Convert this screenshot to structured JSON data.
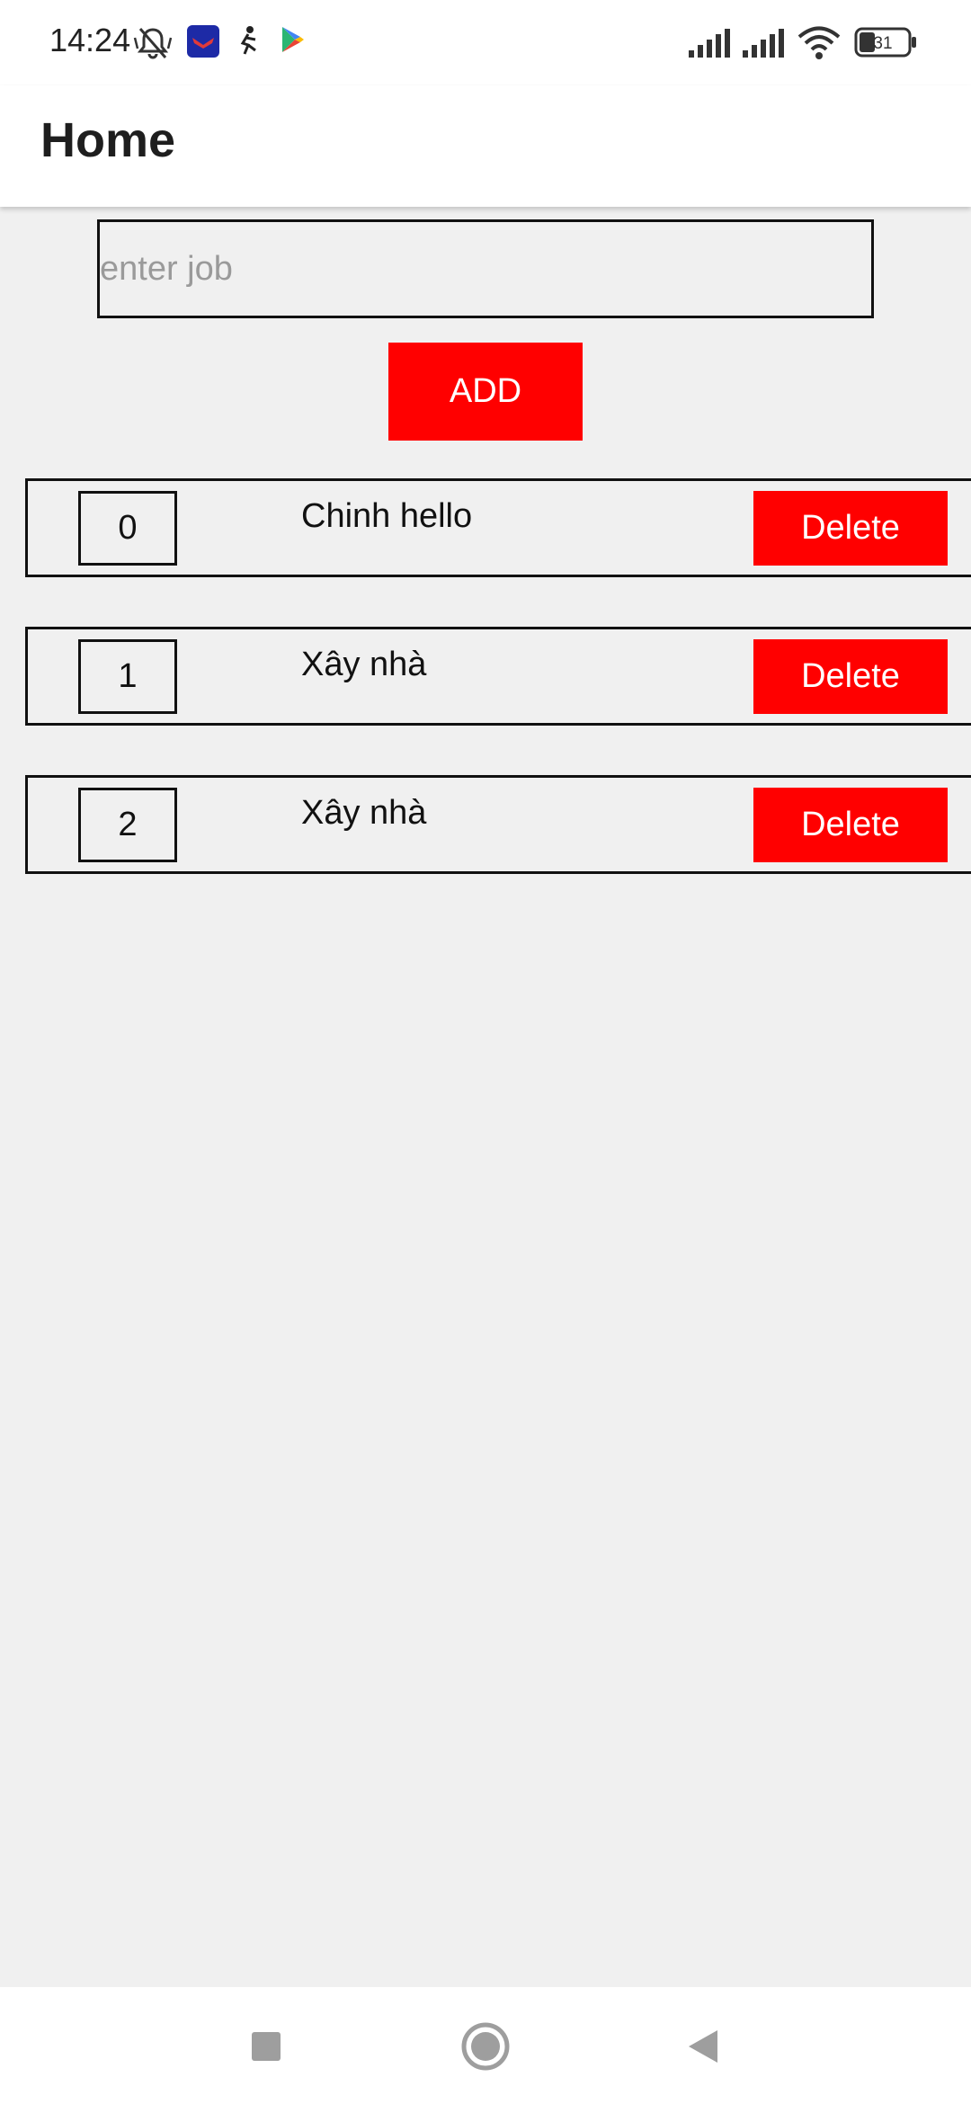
{
  "status_bar": {
    "time": "14:24",
    "battery": "31"
  },
  "app_bar": {
    "title": "Home"
  },
  "form": {
    "input_placeholder": "enter job",
    "input_value": "",
    "add_label": "ADD"
  },
  "jobs": [
    {
      "index": "0",
      "name": "Chinh hello",
      "delete_label": "Delete"
    },
    {
      "index": "1",
      "name": "Xây nhà",
      "delete_label": "Delete"
    },
    {
      "index": "2",
      "name": "Xây nhà",
      "delete_label": "Delete"
    }
  ],
  "colors": {
    "accent": "#ff0000",
    "background": "#f0f0f0",
    "border": "#111111"
  },
  "icons": {
    "status": [
      "muted-bell-icon",
      "app-notification-icon",
      "sports-app-icon",
      "play-store-icon",
      "signal-icon",
      "signal-icon",
      "wifi-icon",
      "battery-icon"
    ],
    "nav": [
      "recents-icon",
      "home-icon",
      "back-icon"
    ]
  }
}
